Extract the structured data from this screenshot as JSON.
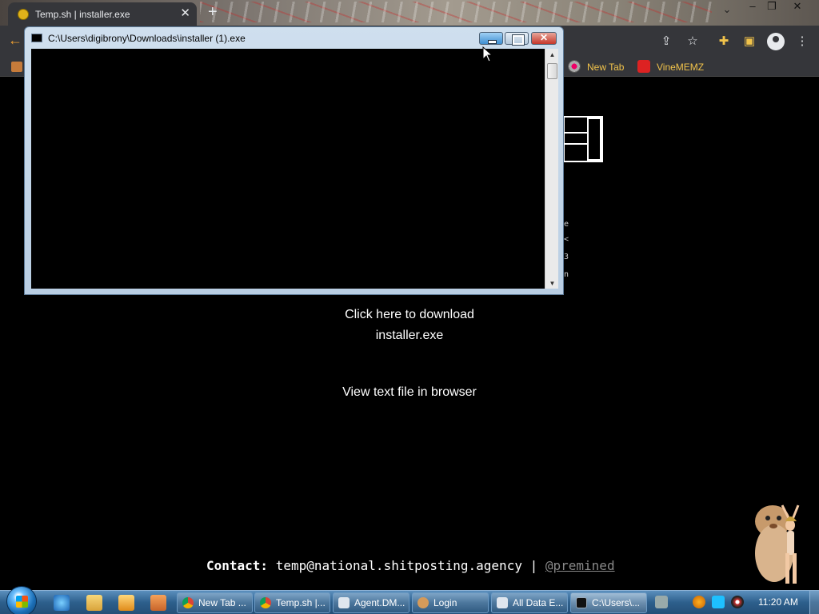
{
  "browser": {
    "tab_title": "Temp.sh | installer.exe",
    "bookmarks": [
      {
        "label": "New Tab",
        "icon": "globe-icon"
      },
      {
        "label": "VineMEMZ",
        "icon": "r-logo-icon"
      }
    ]
  },
  "page": {
    "download_line1": "Click here to download",
    "download_line2": "installer.exe",
    "view_text": "View text file in browser",
    "contact_label": "Contact:",
    "contact_email": "temp@national.shitposting.agency",
    "contact_sep": "|",
    "contact_handle": "@premined",
    "stray_chars": [
      "e",
      "<",
      "3",
      "n"
    ]
  },
  "console": {
    "title": "C:\\Users\\digibrony\\Downloads\\installer (1).exe"
  },
  "taskbar": {
    "items": [
      {
        "label": "New Tab ...",
        "icon": "chrome-icon",
        "color": "#2f9e44"
      },
      {
        "label": "Temp.sh |...",
        "icon": "chrome-icon",
        "color": "#2f9e44"
      },
      {
        "label": "Agent.DM...",
        "icon": "window-icon",
        "color": "#dfe6ee"
      },
      {
        "label": "Login",
        "icon": "user-icon",
        "color": "#d49a5a"
      },
      {
        "label": "All Data E...",
        "icon": "window-icon",
        "color": "#dfe6ee"
      },
      {
        "label": "C:\\Users\\...",
        "icon": "console-icon",
        "color": "#111111"
      }
    ],
    "clock": "11:20 AM"
  },
  "colors": {
    "bookmark_text": "#f1c34b",
    "taskbar": "#2d5f8c",
    "page_bg": "#000000"
  }
}
